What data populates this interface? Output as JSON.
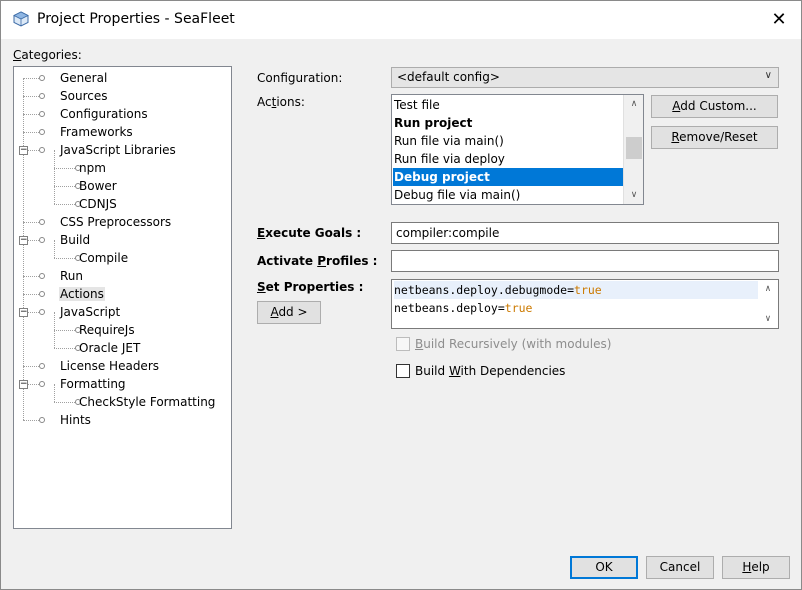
{
  "window": {
    "title": "Project Properties - SeaFleet"
  },
  "categories": {
    "label": "Categories:",
    "items": [
      {
        "label": "General",
        "level": 0,
        "expander": "",
        "selected": false
      },
      {
        "label": "Sources",
        "level": 0,
        "expander": "",
        "selected": false
      },
      {
        "label": "Configurations",
        "level": 0,
        "expander": "",
        "selected": false
      },
      {
        "label": "Frameworks",
        "level": 0,
        "expander": "",
        "selected": false
      },
      {
        "label": "JavaScript Libraries",
        "level": 0,
        "expander": "minus",
        "selected": false
      },
      {
        "label": "npm",
        "level": 1,
        "expander": "",
        "selected": false
      },
      {
        "label": "Bower",
        "level": 1,
        "expander": "",
        "selected": false
      },
      {
        "label": "CDNJS",
        "level": 1,
        "expander": "",
        "selected": false
      },
      {
        "label": "CSS Preprocessors",
        "level": 0,
        "expander": "",
        "selected": false
      },
      {
        "label": "Build",
        "level": 0,
        "expander": "minus",
        "selected": false
      },
      {
        "label": "Compile",
        "level": 1,
        "expander": "",
        "selected": false
      },
      {
        "label": "Run",
        "level": 0,
        "expander": "",
        "selected": false
      },
      {
        "label": "Actions",
        "level": 0,
        "expander": "",
        "selected": true
      },
      {
        "label": "JavaScript",
        "level": 0,
        "expander": "minus",
        "selected": false
      },
      {
        "label": "RequireJs",
        "level": 1,
        "expander": "",
        "selected": false
      },
      {
        "label": "Oracle JET",
        "level": 1,
        "expander": "",
        "selected": false
      },
      {
        "label": "License Headers",
        "level": 0,
        "expander": "",
        "selected": false
      },
      {
        "label": "Formatting",
        "level": 0,
        "expander": "minus",
        "selected": false
      },
      {
        "label": "CheckStyle Formatting",
        "level": 1,
        "expander": "",
        "selected": false
      },
      {
        "label": "Hints",
        "level": 0,
        "expander": "",
        "selected": false
      }
    ]
  },
  "configuration": {
    "label": "Configuration:",
    "value": "<default config>"
  },
  "actions": {
    "label": "Actions:",
    "items": [
      {
        "label": "Test file",
        "bold": false,
        "selected": false
      },
      {
        "label": "Run project",
        "bold": true,
        "selected": false
      },
      {
        "label": "Run file via main()",
        "bold": false,
        "selected": false
      },
      {
        "label": "Run file via deploy",
        "bold": false,
        "selected": false
      },
      {
        "label": "Debug project",
        "bold": true,
        "selected": true
      },
      {
        "label": "Debug file via main()",
        "bold": false,
        "selected": false
      }
    ],
    "add_custom": "Add Custom...",
    "remove_reset": "Remove/Reset"
  },
  "execute_goals": {
    "label": "Execute Goals :",
    "value": "compiler:compile"
  },
  "activate_profiles": {
    "label": "Activate Profiles :",
    "value": ""
  },
  "set_properties": {
    "label": "Set Properties :",
    "add_button": "Add >",
    "lines": [
      {
        "key": "netbeans.deploy.debugmode=",
        "val": "true"
      },
      {
        "key": "netbeans.deploy=",
        "val": "true"
      }
    ]
  },
  "build_recursively": {
    "label": "Build Recursively (with modules)",
    "checked": false,
    "enabled": false
  },
  "build_with_dependencies": {
    "label": "Build With Dependencies",
    "checked": false,
    "enabled": true
  },
  "buttons": {
    "ok": "OK",
    "cancel": "Cancel",
    "help": "Help"
  },
  "colors": {
    "selection": "#0078d7",
    "keyword": "#cc7a00",
    "background": "#f0f0f0"
  }
}
